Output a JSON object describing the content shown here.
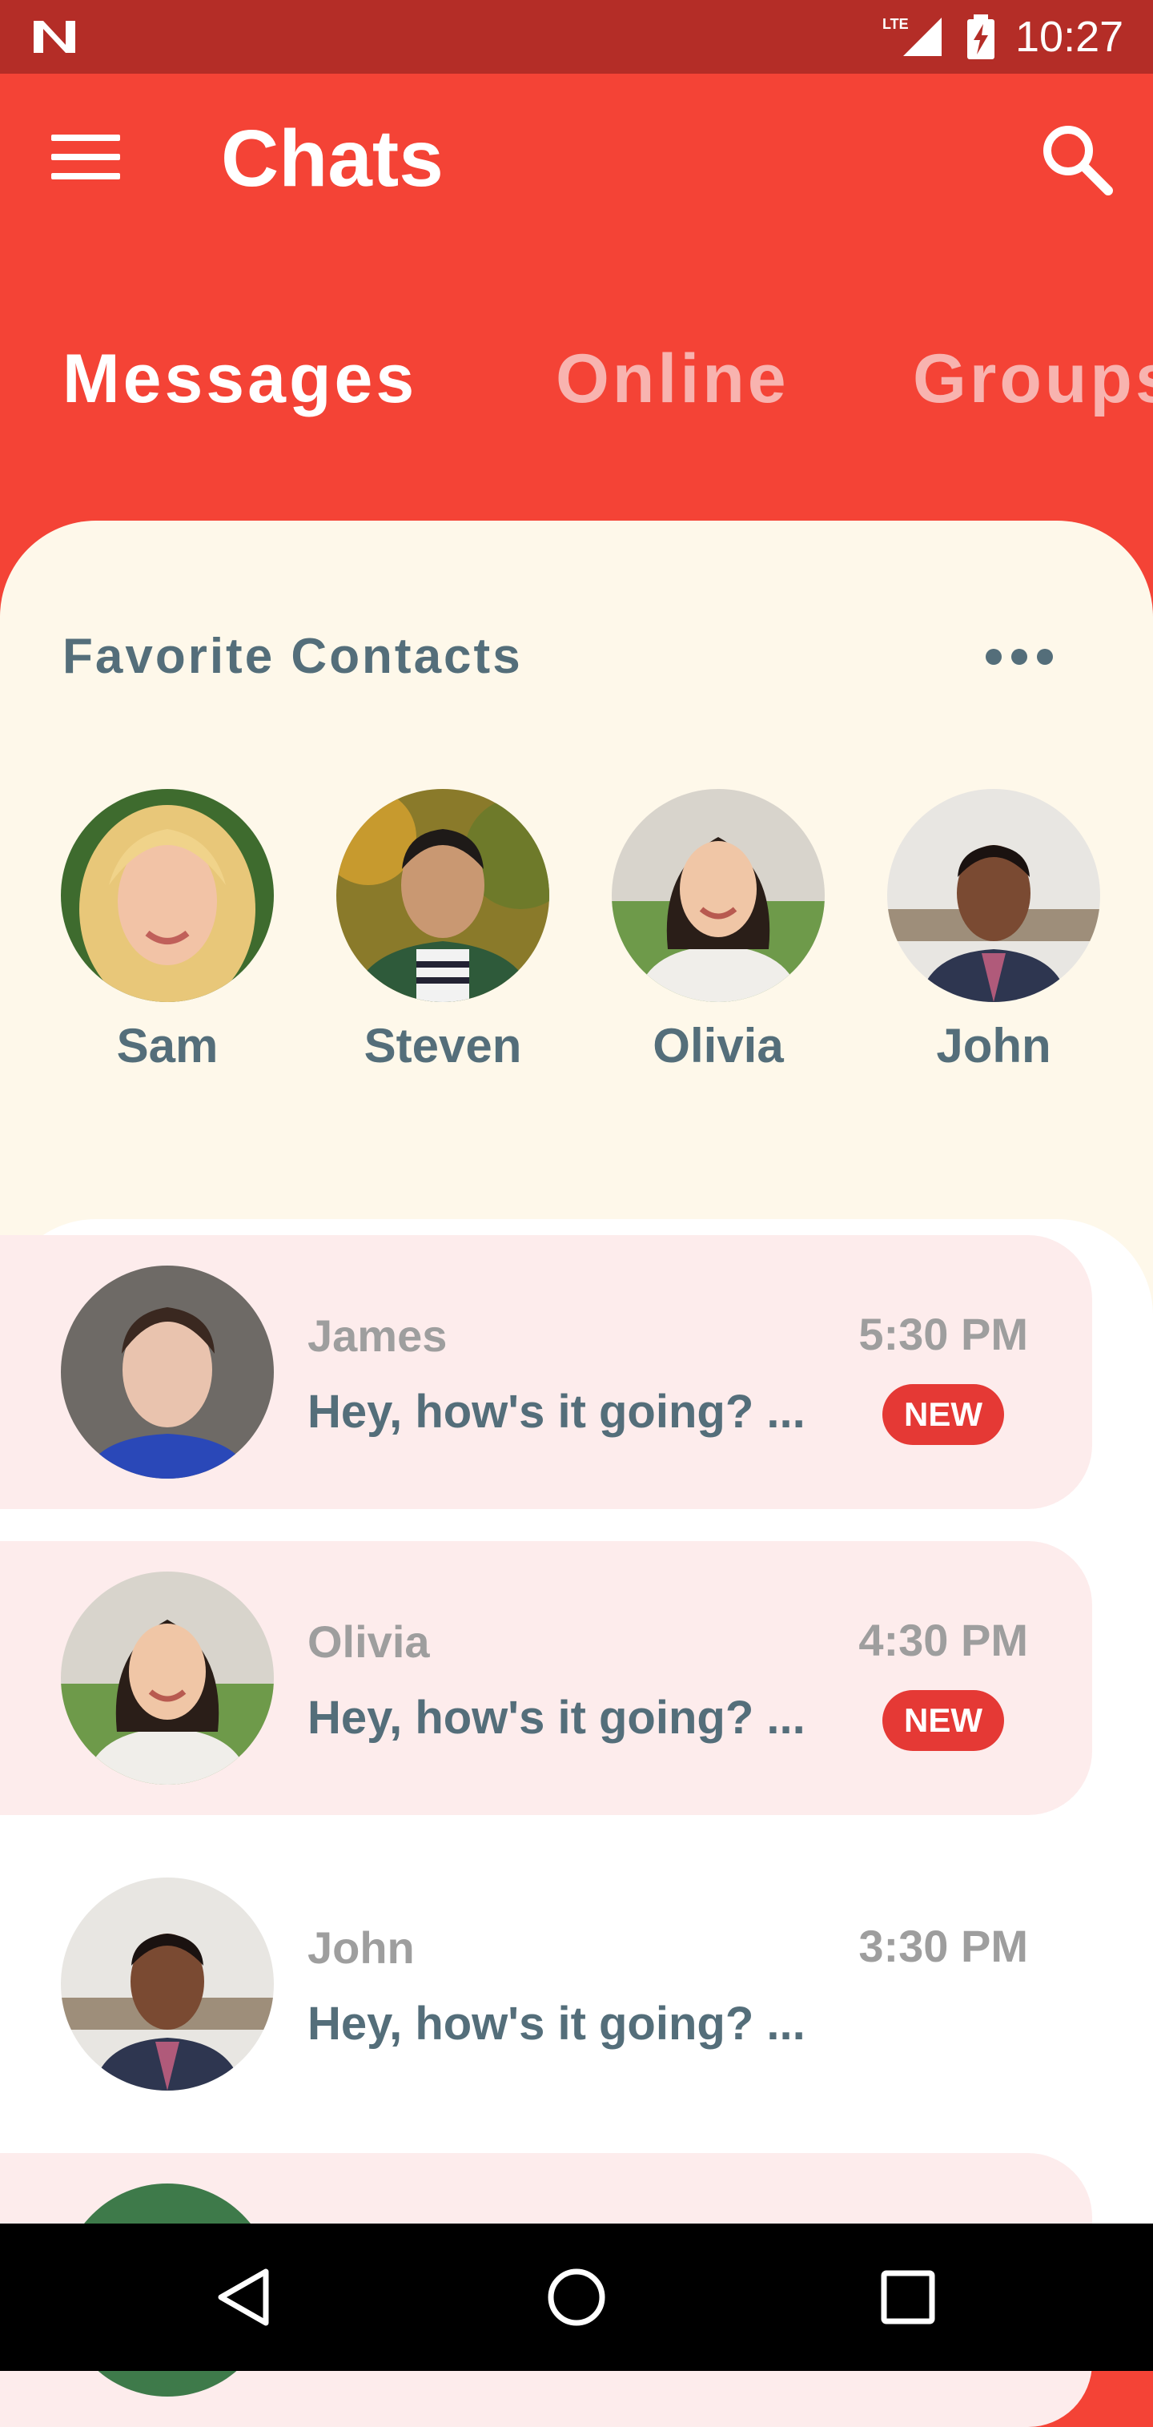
{
  "status_bar": {
    "network": "LTE",
    "time": "10:27",
    "icons": [
      "n-logo-icon",
      "lte-signal-icon",
      "battery-charging-icon"
    ]
  },
  "app_bar": {
    "title": "Chats",
    "menu_icon": "hamburger-menu-icon",
    "search_icon": "search-icon"
  },
  "tabs": [
    {
      "label": "Messages",
      "active": true
    },
    {
      "label": "Online",
      "active": false
    },
    {
      "label": "Groups",
      "active": false
    }
  ],
  "favorites": {
    "title": "Favorite Contacts",
    "more_icon": "more-horizontal-icon",
    "contacts": [
      {
        "name": "Sam"
      },
      {
        "name": "Steven"
      },
      {
        "name": "Olivia"
      },
      {
        "name": "John"
      }
    ]
  },
  "chats": [
    {
      "sender": "James",
      "preview": "Hey, how's it going? ...",
      "time": "5:30 PM",
      "unread": true,
      "badge": "NEW"
    },
    {
      "sender": "Olivia",
      "preview": "Hey, how's it going? ...",
      "time": "4:30 PM",
      "unread": true,
      "badge": "NEW"
    },
    {
      "sender": "John",
      "preview": "Hey, how's it going? ...",
      "time": "3:30 PM",
      "unread": false,
      "badge": ""
    }
  ],
  "colors": {
    "primary": "#F44336",
    "status_bar": "#B42D27",
    "panel": "#FEF8EA",
    "unread_row": "#FDECEC",
    "text_slate": "#546E7A",
    "badge": "#E53935"
  },
  "nav_bar": {
    "icons": [
      "back-icon",
      "home-icon",
      "recents-icon"
    ]
  }
}
